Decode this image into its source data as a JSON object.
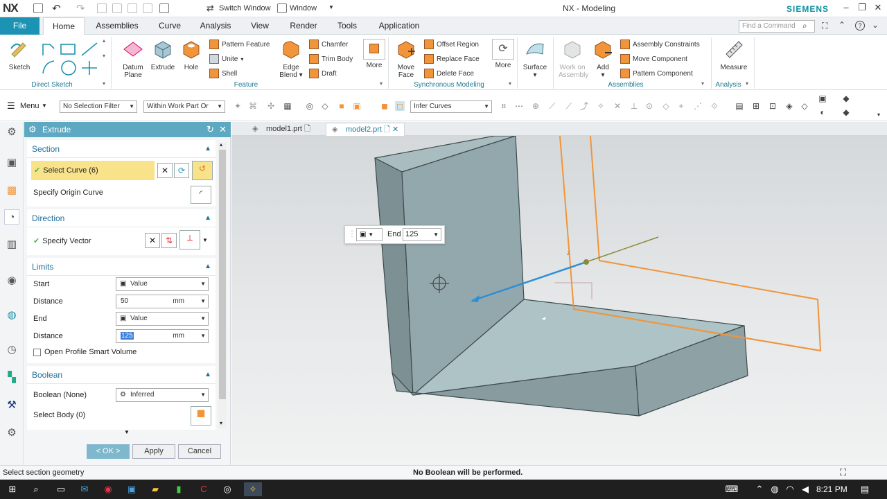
{
  "titlebar": {
    "logo": "NX",
    "switch_window": "Switch Window",
    "window_menu": "Window",
    "app_title": "NX - Modeling",
    "brand": "SIEMENS"
  },
  "tabs": {
    "file": "File",
    "items": [
      "Home",
      "Assemblies",
      "Curve",
      "Analysis",
      "View",
      "Render",
      "Tools",
      "Application"
    ],
    "search_placeholder": "Find a Command"
  },
  "ribbon": {
    "direct_sketch": {
      "sketch": "Sketch",
      "group": "Direct Sketch"
    },
    "feature": {
      "datum": "Datum",
      "plane": "Plane",
      "extrude": "Extrude",
      "hole": "Hole",
      "pattern_feature": "Pattern Feature",
      "unite": "Unite",
      "shell": "Shell",
      "edge": "Edge",
      "blend": "Blend",
      "chamfer": "Chamfer",
      "trim_body": "Trim Body",
      "draft": "Draft",
      "more": "More",
      "group": "Feature"
    },
    "sync": {
      "move": "Move",
      "face": "Face",
      "offset_region": "Offset Region",
      "replace_face": "Replace Face",
      "delete_face": "Delete Face",
      "more": "More",
      "group": "Synchronous Modeling"
    },
    "surface": {
      "label": "Surface"
    },
    "assemblies": {
      "work_on": "Work on",
      "assembly": "Assembly",
      "add": "Add",
      "assembly_constraints": "Assembly Constraints",
      "move_component": "Move Component",
      "pattern_component": "Pattern Component",
      "group": "Assemblies"
    },
    "analysis": {
      "measure": "Measure",
      "group": "Analysis"
    }
  },
  "toolbar": {
    "menu": "Menu",
    "selection_filter": "No Selection Filter",
    "scope": "Within Work Part Or",
    "infer": "Infer Curves"
  },
  "dialog": {
    "title": "Extrude",
    "section": {
      "header": "Section",
      "select_curve": "Select Curve (6)",
      "origin_curve": "Specify Origin Curve"
    },
    "direction": {
      "header": "Direction",
      "specify_vector": "Specify Vector"
    },
    "limits": {
      "header": "Limits",
      "start": "Start",
      "start_value": "Value",
      "distance": "Distance",
      "start_distance": "50",
      "unit": "mm",
      "end": "End",
      "end_value": "Value",
      "end_distance": "125",
      "open_profile": "Open Profile Smart Volume"
    },
    "boolean": {
      "header": "Boolean",
      "label": "Boolean (None)",
      "value": "Inferred",
      "select_body": "Select Body (0)"
    },
    "buttons": {
      "ok": "< OK >",
      "apply": "Apply",
      "cancel": "Cancel"
    }
  },
  "viewport": {
    "tabs": [
      "model1.prt",
      "model2.prt"
    ],
    "float_end_label": "End",
    "float_end_value": "125"
  },
  "status": {
    "left": "Select section geometry",
    "center": "No Boolean will be performed."
  },
  "taskbar": {
    "time": "8:21 PM"
  },
  "colors": {
    "accent": "#1c93b3",
    "dialog_title": "#5ea8c2",
    "highlight": "#f9e38a",
    "preview": "#f0953a",
    "model": "#8fa4a8"
  }
}
